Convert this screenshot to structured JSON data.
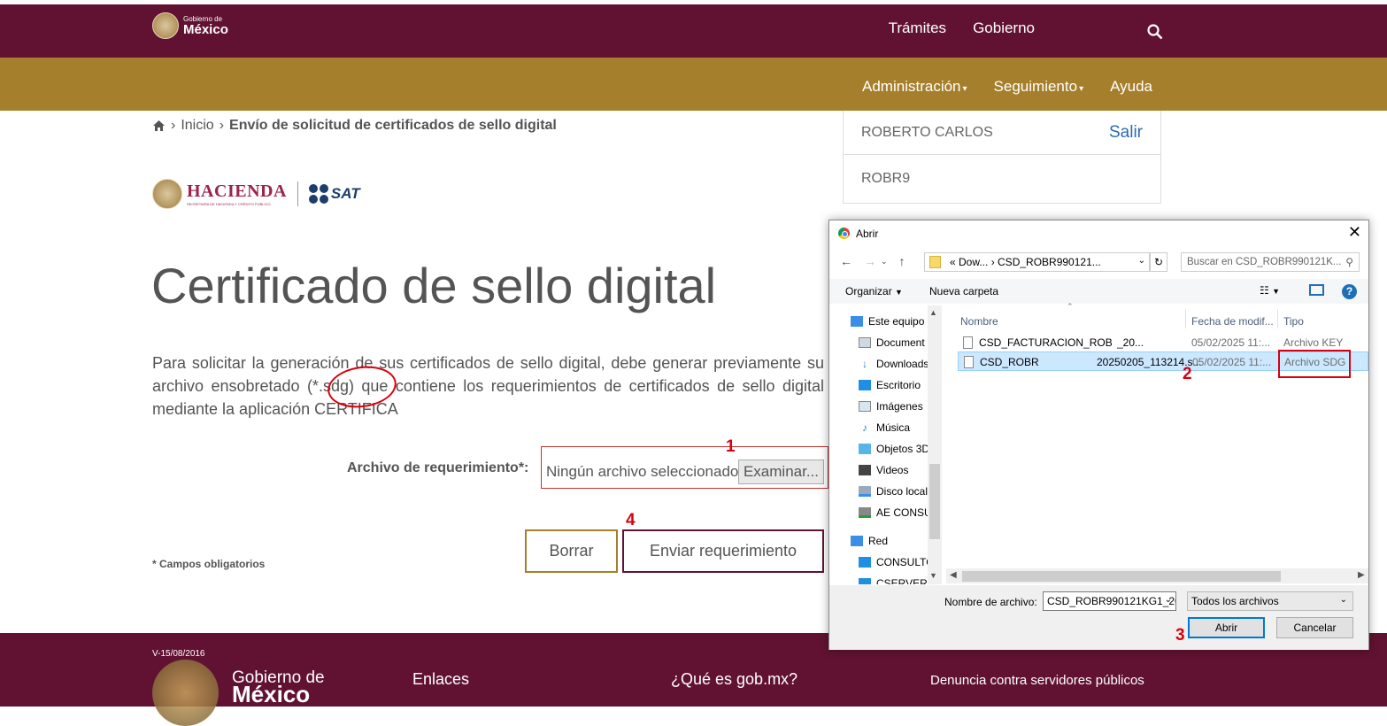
{
  "header": {
    "logo_small": "Gobierno de",
    "logo_big": "México",
    "nav": [
      "Trámites",
      "Gobierno"
    ]
  },
  "subnav": {
    "items": [
      "Administración",
      "Seguimiento",
      "Ayuda"
    ]
  },
  "breadcrumb": {
    "home": "Inicio",
    "current": "Envío de solicitud de certificados de sello digital"
  },
  "user": {
    "name": "ROBERTO CARLOS",
    "logout": "Salir",
    "rfc": "ROBR9"
  },
  "branding": {
    "hacienda": "HACIENDA",
    "hacienda_sub": "SECRETARÍA DE HACIENDA Y CRÉDITO PÚBLICO",
    "sat": "SAT"
  },
  "page": {
    "title": "Certificado de sello digital",
    "description": "Para solicitar la generación de sus certificados de sello digital, debe generar previamente su archivo ensobretado (*.sdg) que contiene los requerimientos de certificados de sello digital mediante la aplicación CERTIFICA",
    "file_label": "Archivo de requerimiento*:",
    "file_status": "Ningún archivo seleccionado",
    "browse_button": "Examinar...",
    "clear_button": "Borrar",
    "submit_button": "Enviar requerimiento",
    "required_note": "* Campos obligatorios"
  },
  "annotations": {
    "n1": "1",
    "n2": "2",
    "n3": "3",
    "n4": "4"
  },
  "footer": {
    "version": "V-15/08/2016",
    "gob_line1": "Gobierno de",
    "gob_line2": "México",
    "links": [
      "Enlaces",
      "¿Qué es gob.mx?",
      "Denuncia contra servidores públicos"
    ]
  },
  "dialog": {
    "title": "Abrir",
    "address": "« Dow... › CSD_ROBR990121...",
    "search_placeholder": "Buscar en CSD_ROBR990121K...",
    "organize": "Organizar",
    "new_folder": "Nueva carpeta",
    "nav_items": [
      "Este equipo",
      "Document",
      "Downloads",
      "Escritorio",
      "Imágenes",
      "Música",
      "Objetos 3D",
      "Videos",
      "Disco local",
      "AE CONSU",
      "Red",
      "CONSULTO",
      "CSERVER"
    ],
    "columns": [
      "Nombre",
      "Fecha de modif...",
      "Tipo"
    ],
    "files": [
      {
        "name": "CSD_FACTURACION_ROBR9",
        "name_tail": "_20...",
        "date": "05/02/2025 11:...",
        "type": "Archivo KEY"
      },
      {
        "name": "CSD_ROBR",
        "name_tail": "20250205_113214.s...",
        "date": "05/02/2025 11:...",
        "type": "Archivo SDG"
      }
    ],
    "filename_label": "Nombre de archivo:",
    "filename_value": "CSD_ROBR990121KG1_20",
    "filter_value": "Todos los archivos",
    "open_button": "Abrir",
    "cancel_button": "Cancelar"
  },
  "colors": {
    "primary": "#611232",
    "gold": "#a57f2c",
    "annotation_red": "#d9000d"
  }
}
